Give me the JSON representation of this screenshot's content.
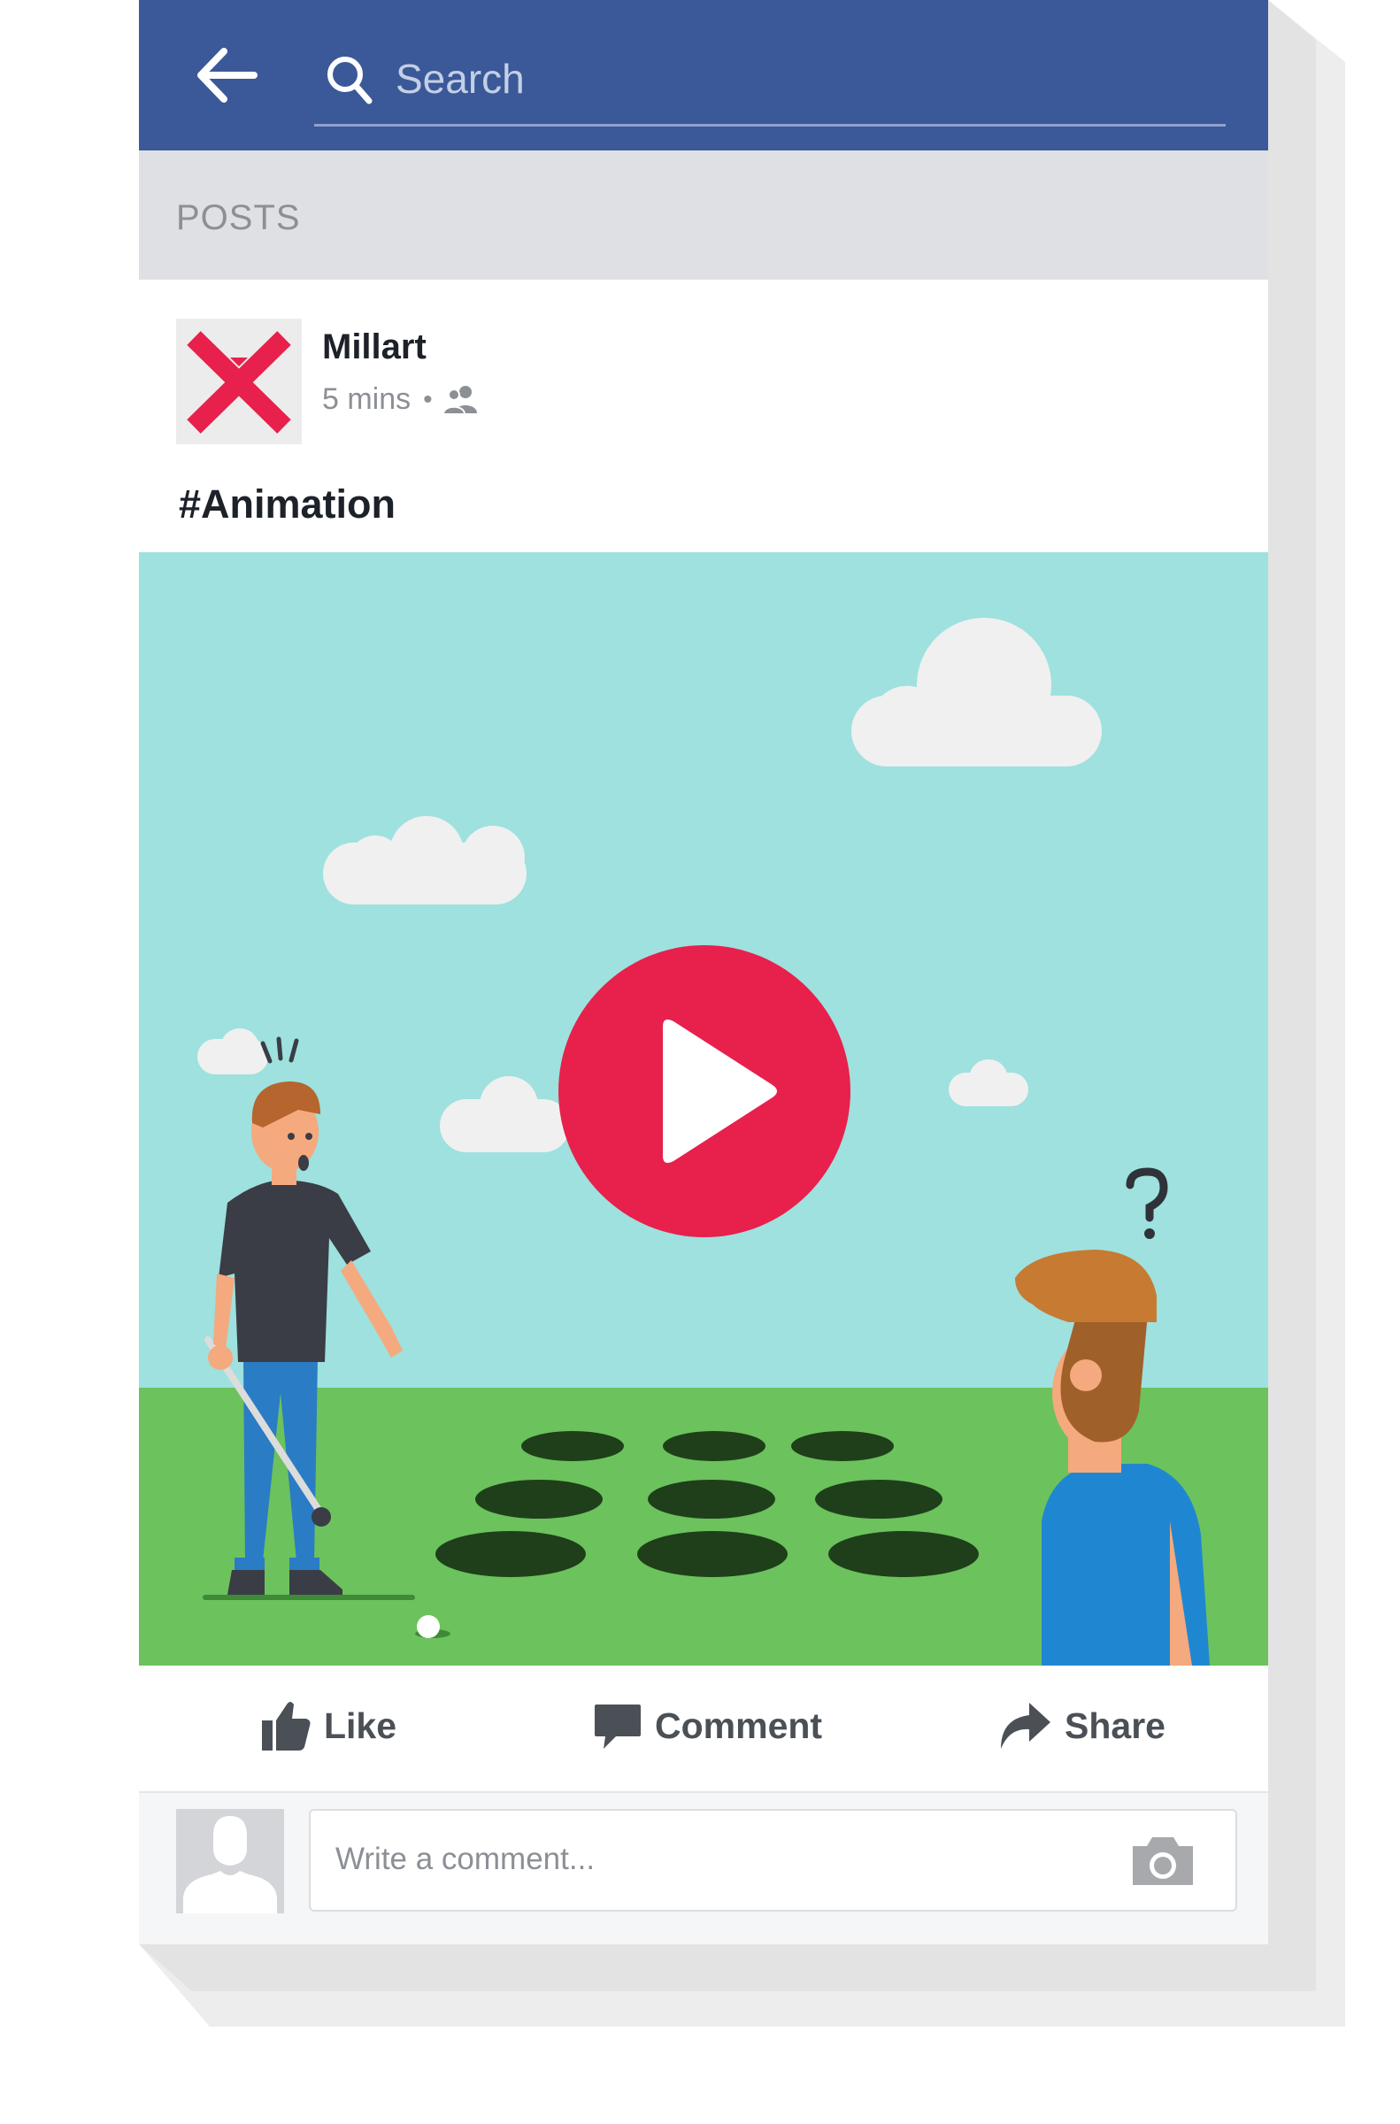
{
  "search": {
    "placeholder": "Search"
  },
  "sections": {
    "posts_label": "POSTS"
  },
  "post": {
    "author": "Millart",
    "time": "5 mins",
    "separator": "•",
    "audience_icon": "friends-icon",
    "text": "#Animation",
    "media_type": "video"
  },
  "actions": {
    "like": "Like",
    "comment": "Comment",
    "share": "Share"
  },
  "comment": {
    "placeholder": "Write a comment..."
  },
  "colors": {
    "header_blue": "#3b5998",
    "sky": "#9ee1de",
    "grass": "#6cc25c",
    "play_red": "#e8204c",
    "logo_red": "#e8204c"
  }
}
